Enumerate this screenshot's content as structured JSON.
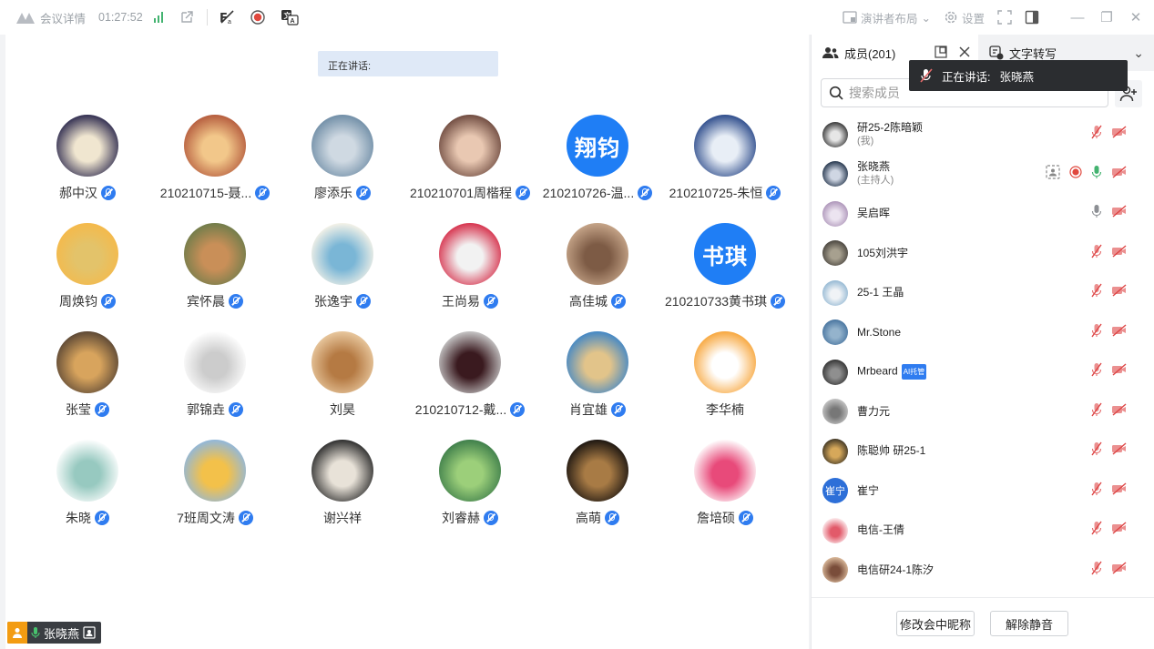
{
  "topbar": {
    "meeting_info": "会议详情",
    "elapsed": "01:27:52",
    "layout_label": "演讲者布局",
    "settings_label": "设置"
  },
  "main": {
    "speaking_label": "正在讲话:",
    "self_name": "张晓燕",
    "participants": [
      {
        "name": "郝中汉",
        "avatar": "photo-dark-character",
        "colors": [
          "#2e2b4f",
          "#f0e6d0"
        ]
      },
      {
        "name": "210210715-聂...",
        "avatar": "photo-anime-kids",
        "colors": [
          "#b45a3c",
          "#f2c78a"
        ]
      },
      {
        "name": "廖添乐",
        "avatar": "photo-mountain-lake",
        "colors": [
          "#6f8da6",
          "#cfd9e2"
        ]
      },
      {
        "name": "210210701周楷程",
        "avatar": "photo-anime-boy",
        "colors": [
          "#6e4a3f",
          "#e9c8b2"
        ]
      },
      {
        "name": "210210726-温...",
        "avatar_text": "翔钧"
      },
      {
        "name": "210210725-朱恒",
        "avatar": "photo-anime-blue-hair",
        "colors": [
          "#2b4a8a",
          "#e8eef6"
        ]
      },
      {
        "name": "周焕钧",
        "avatar": "photo-cartoon-face",
        "colors": [
          "#f5b94a",
          "#e3c36a"
        ]
      },
      {
        "name": "宾怀晨",
        "avatar": "photo-cat-sleeping",
        "colors": [
          "#6f7c4a",
          "#c98f58"
        ]
      },
      {
        "name": "张逸宇",
        "avatar": "photo-toys",
        "colors": [
          "#f7f3e8",
          "#7ab6d6"
        ]
      },
      {
        "name": "王尚易",
        "avatar": "photo-red-hat",
        "colors": [
          "#d62f4a",
          "#f2f2f2"
        ]
      },
      {
        "name": "高佳城",
        "avatar": "photo-dog",
        "colors": [
          "#c7a68a",
          "#7d5b45"
        ]
      },
      {
        "name": "210210733黄书琪",
        "avatar_text": "书琪"
      },
      {
        "name": "张莹",
        "avatar": "photo-train-window",
        "colors": [
          "#5a4634",
          "#d8a45d"
        ]
      },
      {
        "name": "郭锦垚",
        "avatar": "photo-sketch-figure",
        "colors": [
          "#ffffff",
          "#cccccc"
        ]
      },
      {
        "name": "刘昊",
        "avatar": "photo-shiba-dog",
        "colors": [
          "#e9c9a0",
          "#b57a43"
        ]
      },
      {
        "name": "210210712-戴...",
        "avatar": "photo-anime-girl",
        "colors": [
          "#c9c9c9",
          "#3a1a1f"
        ]
      },
      {
        "name": "肖宜雄",
        "avatar": "photo-windmill",
        "colors": [
          "#3f86c7",
          "#e2c48a"
        ]
      },
      {
        "name": "李华楠",
        "avatar": "photo-cartoon-dog",
        "colors": [
          "#f7a53a",
          "#ffffff"
        ]
      },
      {
        "name": "朱晓",
        "avatar": "photo-hello-plant",
        "colors": [
          "#ffffff",
          "#97c9c0"
        ]
      },
      {
        "name": "7班周文涛",
        "avatar": "photo-naruto",
        "colors": [
          "#8fb7de",
          "#f3c14a"
        ]
      },
      {
        "name": "谢兴祥",
        "avatar": "photo-white-flower",
        "colors": [
          "#2b2b2b",
          "#e8e2d8"
        ]
      },
      {
        "name": "刘睿赫",
        "avatar": "photo-green-ghibli",
        "colors": [
          "#3d7d4a",
          "#9ccf7a"
        ]
      },
      {
        "name": "高萌",
        "avatar": "photo-night-field",
        "colors": [
          "#1a1410",
          "#a87b45"
        ]
      },
      {
        "name": "詹培硕",
        "avatar": "photo-pink-flower",
        "colors": [
          "#ffffff",
          "#e84a7a"
        ]
      }
    ]
  },
  "panel": {
    "members_tab": "成员(201)",
    "transcript_tab": "文字转写",
    "tooltip_label": "正在讲话:",
    "tooltip_name": "张晓燕",
    "search_placeholder": "搜索成员",
    "members": [
      {
        "name": "研25-2陈暗颖",
        "sub": "(我)",
        "colors": [
          "#222",
          "#e6e6e6"
        ],
        "mic": "muted"
      },
      {
        "name": "张晓燕",
        "sub": "(主持人)",
        "colors": [
          "#10223a",
          "#cfd6e3"
        ],
        "mic": "on",
        "host": true
      },
      {
        "name": "吴启晖",
        "colors": [
          "#a58bb2",
          "#ece4f0"
        ],
        "mic": "off-grey"
      },
      {
        "name": "105刘洪宇",
        "colors": [
          "#3e3a35",
          "#a7a08f"
        ],
        "mic": "muted"
      },
      {
        "name": "25-1 王晶",
        "colors": [
          "#89b1cf",
          "#f0f3f6"
        ],
        "mic": "muted"
      },
      {
        "name": "Mr.Stone",
        "colors": [
          "#3f6d9a",
          "#94b3cc"
        ],
        "mic": "muted"
      },
      {
        "name": "Mrbeard",
        "badge": "AI托管",
        "colors": [
          "#2a2a2a",
          "#8f8f8f"
        ],
        "mic": "muted"
      },
      {
        "name": "曹力元",
        "colors": [
          "#cfcfcf",
          "#777"
        ],
        "mic": "muted"
      },
      {
        "name": "陈聪帅 研25-1",
        "colors": [
          "#2f2a20",
          "#d6a85a"
        ],
        "mic": "muted"
      },
      {
        "name": "崔宁",
        "avatar_text": "崔宁",
        "mic": "muted"
      },
      {
        "name": "电信-王倩",
        "colors": [
          "#ffffff",
          "#e25a6a"
        ],
        "mic": "muted"
      },
      {
        "name": "电信研24-1陈汐",
        "colors": [
          "#e7c8a8",
          "#7a4d3a"
        ],
        "mic": "muted"
      }
    ],
    "rename_button": "修改会中昵称",
    "unmute_button": "解除静音"
  },
  "colors": {
    "accent": "#1f7ef5",
    "muted_icon": "#e46b6b",
    "green": "#43b370"
  }
}
